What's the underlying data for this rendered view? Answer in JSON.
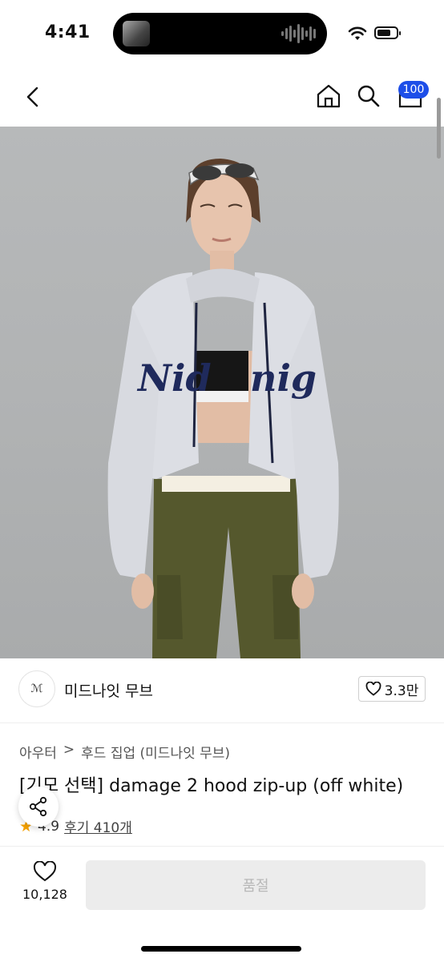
{
  "status_bar": {
    "time": "4:41"
  },
  "nav": {
    "cart_count": "100"
  },
  "brand": {
    "logo_text": "ℳ",
    "name": "미드나잇 무브",
    "likes": "3.3만"
  },
  "breadcrumb": {
    "level1": "아우터",
    "separator": ">",
    "level2": "후드 집업 (미드나잇 무브)"
  },
  "product": {
    "title": "[기모 선택] damage 2 hood zip-up (off white)",
    "rating": "4.9",
    "reviews": "후기 410개",
    "hoodie_print_left": "Nid",
    "hoodie_print_right": "nig"
  },
  "bottom": {
    "wish_count": "10,128",
    "buy_label": "품절"
  },
  "colors": {
    "accent": "#1d4ee8",
    "star": "#f5a100",
    "disabled_bg": "#ececec"
  }
}
